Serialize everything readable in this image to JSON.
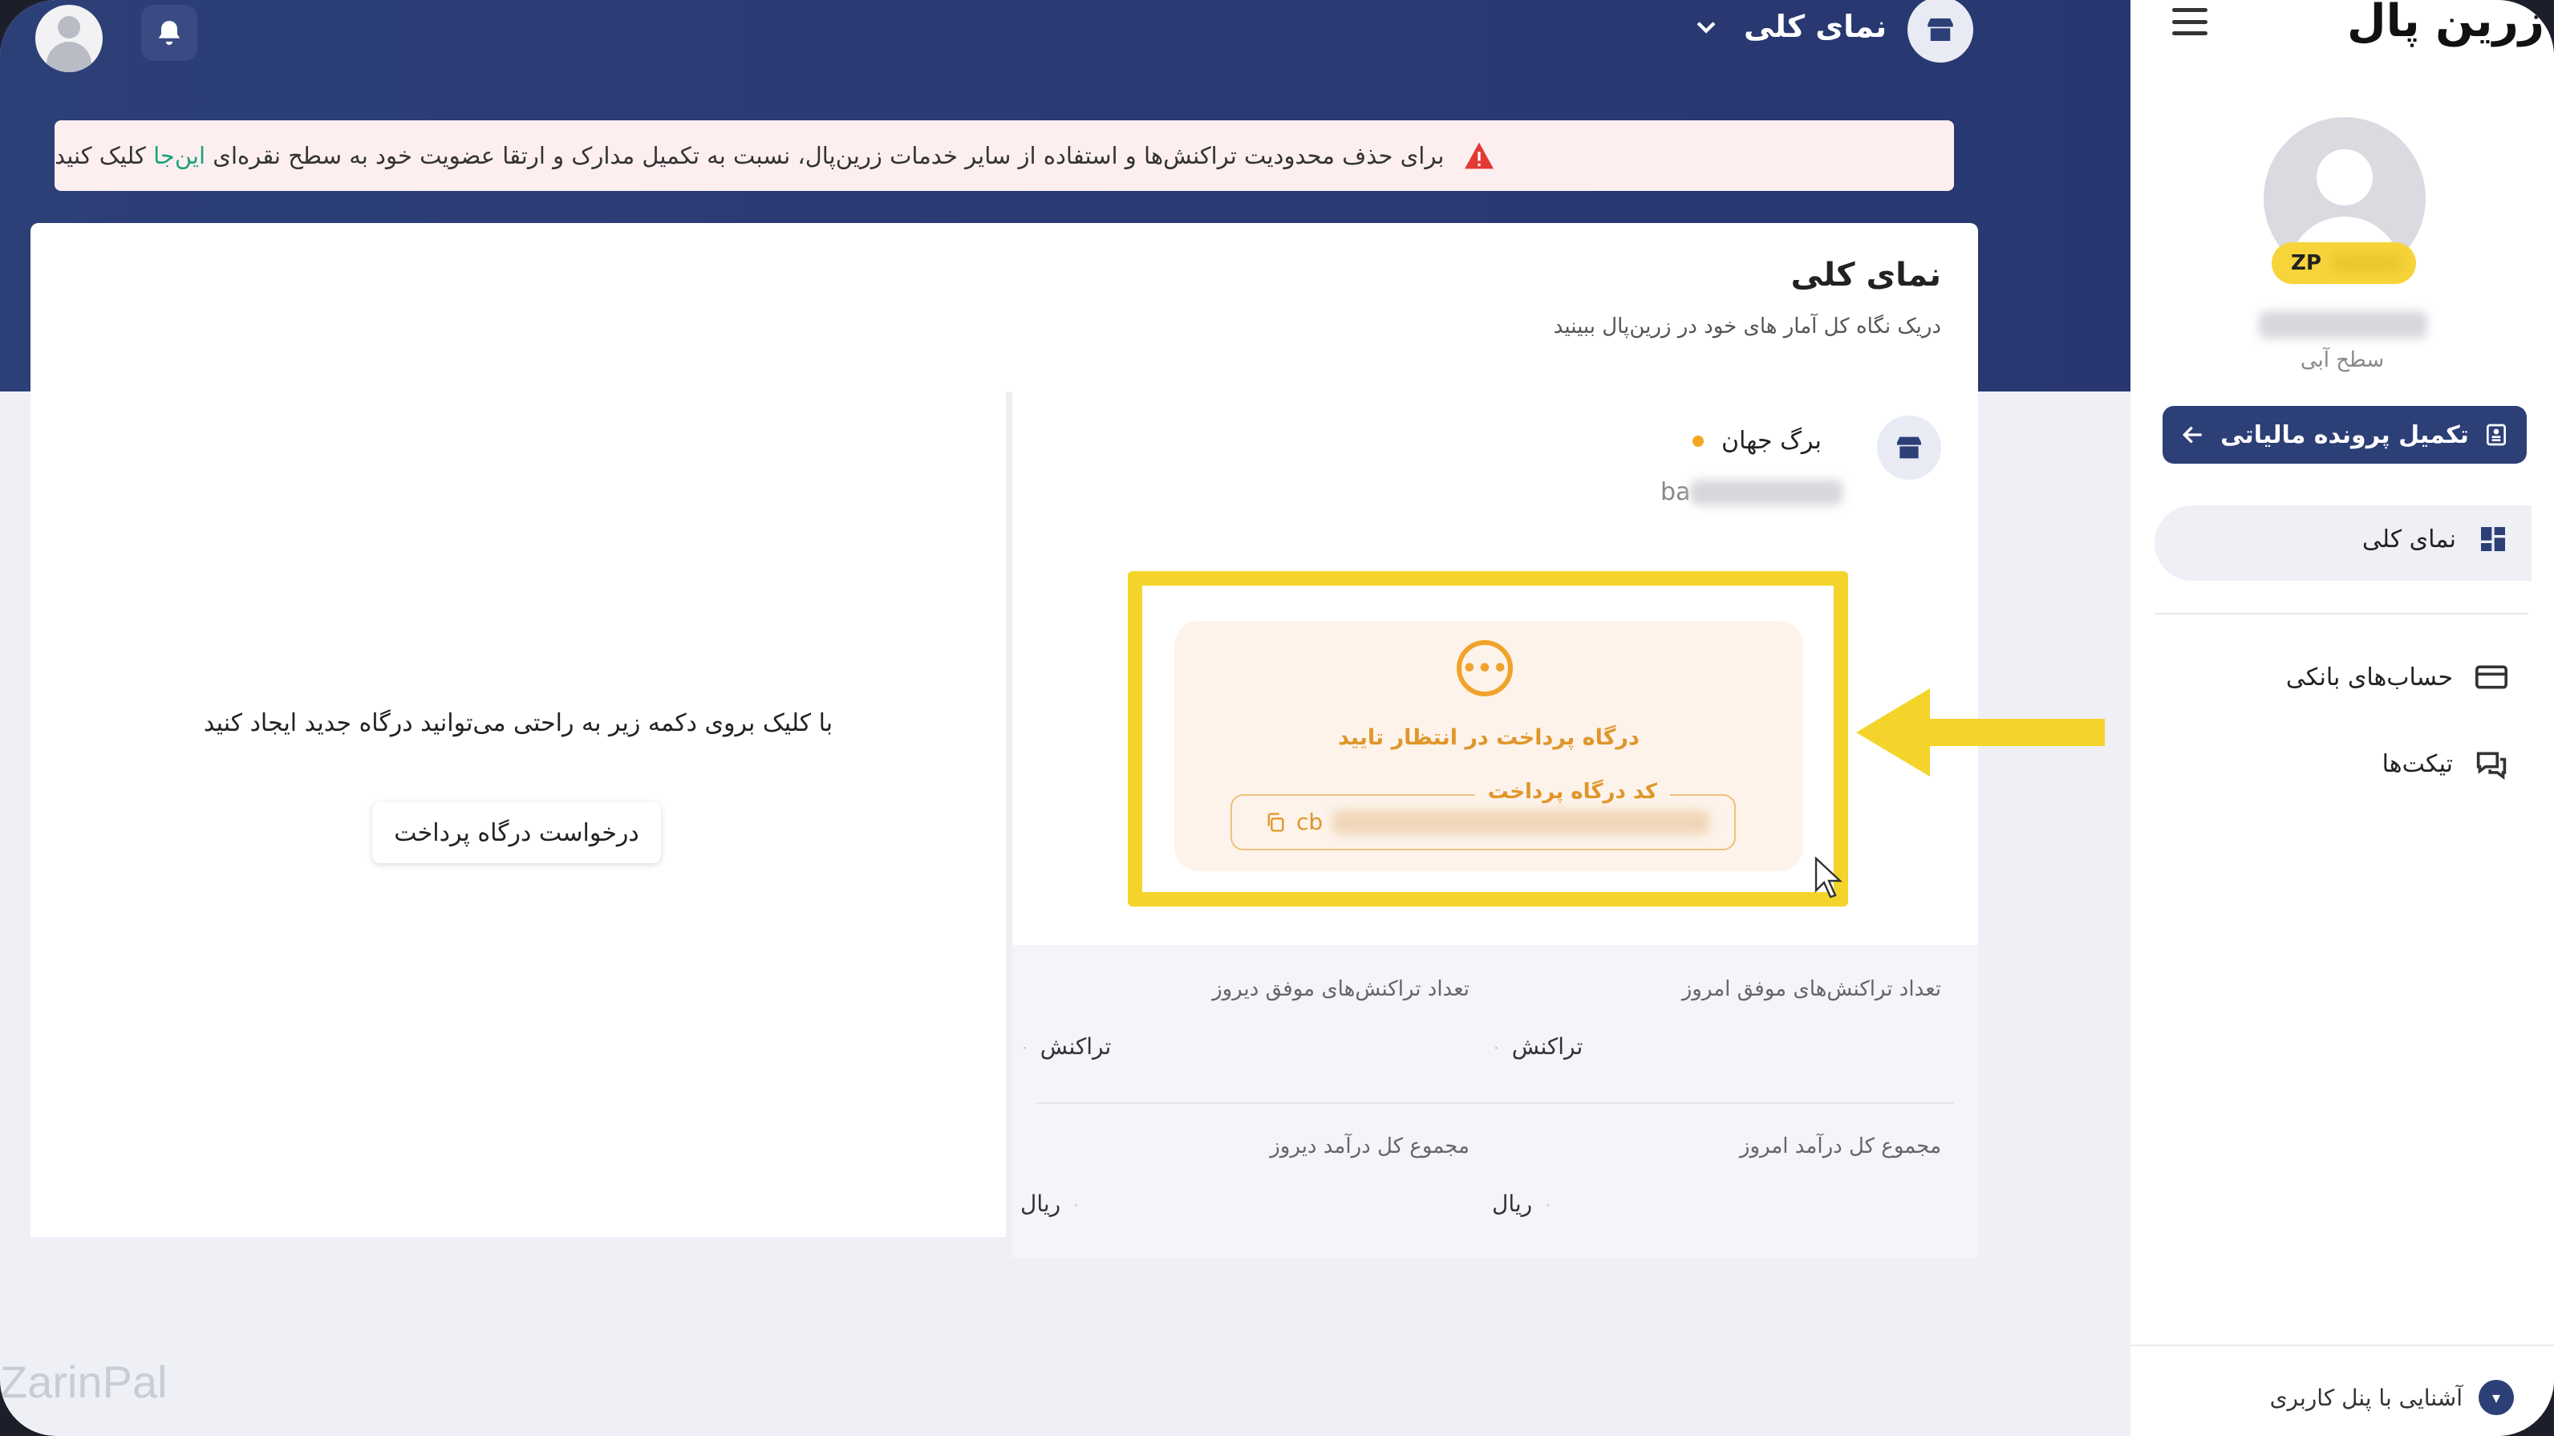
{
  "topbar": {
    "title": "نمای کلی",
    "avatar_icon": "user-avatar-icon",
    "bell_icon": "bell-icon",
    "chevron_icon": "chevron-down-icon",
    "store_icon": "store-icon"
  },
  "alert": {
    "text_before_link": "برای حذف محدودیت تراکنش‌ها و استفاده از سایر خدمات زرین‌پال، نسبت به تکمیل مدارک و ارتقا عضویت خود به سطح نقره‌ای ",
    "link": "این‌جا",
    "text_after_link": " کلیک کنید",
    "icon": "warning-icon",
    "icon_color": "#e53935"
  },
  "main": {
    "title": "نمای کلی",
    "subtitle": "دریک نگاه کل آمار های خود در زرین‌پال ببینید"
  },
  "left_panel": {
    "text": "با کلیک بروی دکمه زیر به راحتی می‌توانید درگاه جدید ایجاد کنید",
    "button": "درخواست درگاه پرداخت"
  },
  "gateway": {
    "name": "برگ جهان",
    "domain_prefix": "ba",
    "status": "درگاه پرداخت در انتظار تایید",
    "code_label": "کد درگاه پرداخت",
    "code_prefix": "cb",
    "status_color": "#e0962a",
    "highlight_color": "#f4d42a"
  },
  "stats": {
    "today_tx_label": "تعداد تراکنش‌های موفق امروز",
    "today_tx_value": "۰",
    "today_tx_unit": "تراکنش",
    "yesterday_tx_label": "تعداد تراکنش‌های موفق دیروز",
    "yesterday_tx_value": "۰",
    "yesterday_tx_unit": "تراکنش",
    "today_income_label": "مجموع کل درآمد امروز",
    "today_income_value": "۰",
    "today_income_unit": "ریال",
    "yesterday_income_label": "مجموع کل درآمد دیروز",
    "yesterday_income_value": "۰",
    "yesterday_income_unit": "ریال"
  },
  "sidebar": {
    "logo": "زرین پال",
    "badge": "ZP",
    "level": "سطح آبی",
    "tax_button": "تکمیل پرونده مالیاتی",
    "items": [
      {
        "label": "نمای کلی",
        "icon": "dashboard-icon"
      },
      {
        "label": "حساب‌های بانکی",
        "icon": "credit-card-icon"
      },
      {
        "label": "تیکت‌ها",
        "icon": "chat-icon"
      }
    ],
    "footer": "آشنایی با پنل کاربری",
    "accent": "#2d3f77"
  },
  "watermark": "ZarinPal"
}
